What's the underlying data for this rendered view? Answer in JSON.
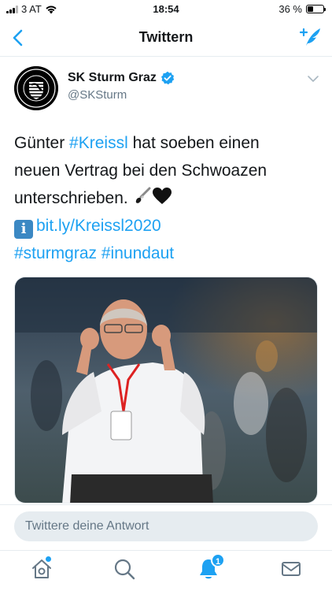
{
  "status_bar": {
    "carrier": "3 AT",
    "time": "18:54",
    "battery_percent_label": "36 %",
    "battery_level": 0.36
  },
  "nav": {
    "title": "Twittern"
  },
  "tweet": {
    "author_name": "SK Sturm Graz",
    "handle": "@SKSturm",
    "text_line1_prefix": "Günter ",
    "hashtag_kreissl": "#Kreissl",
    "text_line1_suffix": " hat soeben einen",
    "text_line2": "neuen Vertrag bei den Schwoazen",
    "text_line3": "unterschrieben. ",
    "link": "bit.ly/Kreissl2020",
    "hashtag_sturmgraz": "#sturmgraz",
    "hashtag_inundaut": "#inundaut"
  },
  "reply": {
    "placeholder": "Twittere deine Antwort"
  },
  "tabs": {
    "notifications_badge": "1"
  },
  "colors": {
    "accent": "#1da1f2",
    "text": "#14171a",
    "secondary_text": "#657786"
  },
  "icons": [
    "back-chevron-icon",
    "compose-tweet-icon",
    "verified-badge-icon",
    "caret-down-icon",
    "info-emoji-icon",
    "paintbrush-emoji-icon",
    "black-heart-emoji-icon",
    "home-icon",
    "search-icon",
    "notifications-bell-icon",
    "messages-envelope-icon"
  ]
}
